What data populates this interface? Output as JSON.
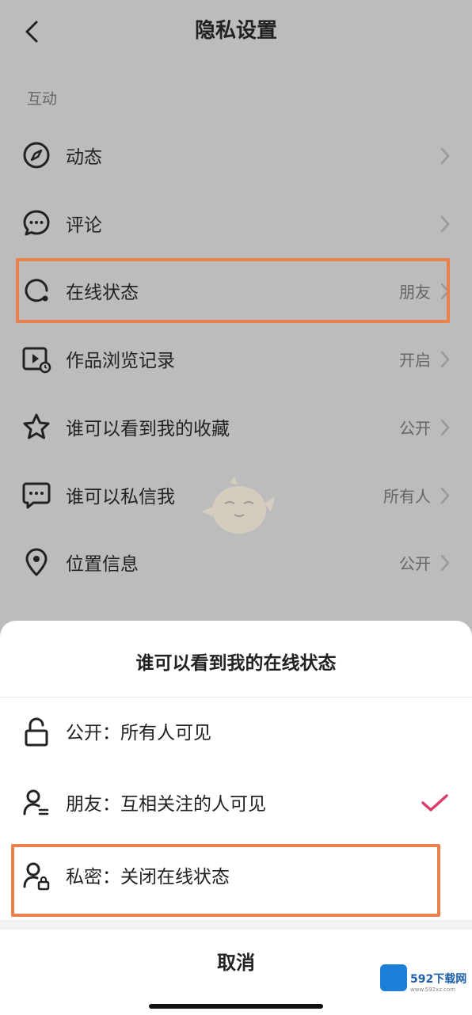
{
  "header": {
    "title": "隐私设置",
    "back_icon": "chevron-left-icon"
  },
  "section_label": "互动",
  "rows": [
    {
      "label": "动态",
      "value": "",
      "icon": "compass-icon"
    },
    {
      "label": "评论",
      "value": "",
      "icon": "comment-bubble-icon"
    },
    {
      "label": "在线状态",
      "value": "朋友",
      "icon": "online-status-icon"
    },
    {
      "label": "作品浏览记录",
      "value": "开启",
      "icon": "video-history-icon"
    },
    {
      "label": "谁可以看到我的收藏",
      "value": "公开",
      "icon": "star-icon"
    },
    {
      "label": "谁可以私信我",
      "value": "所有人",
      "icon": "message-icon"
    },
    {
      "label": "位置信息",
      "value": "公开",
      "icon": "location-pin-icon"
    }
  ],
  "sheet": {
    "title": "谁可以看到我的在线状态",
    "options": [
      {
        "label": "公开：所有人可见",
        "icon": "unlock-icon",
        "selected": false
      },
      {
        "label": "朋友：互相关注的人可见",
        "icon": "user-friends-icon",
        "selected": true
      },
      {
        "label": "私密：关闭在线状态",
        "icon": "user-lock-icon",
        "selected": false
      }
    ],
    "cancel": "取消"
  },
  "watermark": {
    "text": "592下载网",
    "sub": "www.592xz.com"
  },
  "colors": {
    "highlight": "#e9814d",
    "check": "#d6406a",
    "dim_background": "#bcbcbc"
  }
}
